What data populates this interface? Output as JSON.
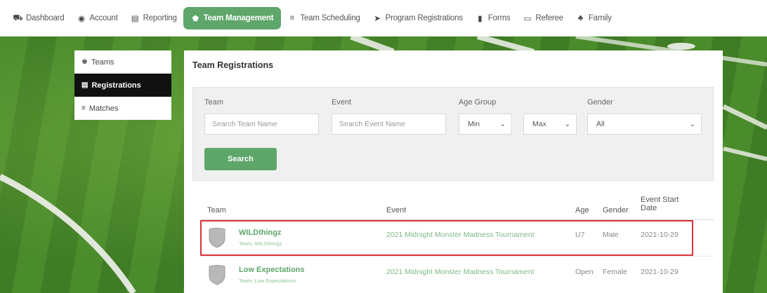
{
  "nav": {
    "items": [
      {
        "label": "Dashboard",
        "icon": "dashboard-icon",
        "glyph": "⛟"
      },
      {
        "label": "Account",
        "icon": "account-icon",
        "glyph": "◉"
      },
      {
        "label": "Reporting",
        "icon": "reporting-icon",
        "glyph": "▤"
      },
      {
        "label": "Team Management",
        "icon": "team-management-icon",
        "glyph": "♚",
        "active": true
      },
      {
        "label": "Team Scheduling",
        "icon": "team-scheduling-icon",
        "glyph": "≡"
      },
      {
        "label": "Program Registrations",
        "icon": "program-registrations-icon",
        "glyph": "➤"
      },
      {
        "label": "Forms",
        "icon": "forms-icon",
        "glyph": "▮"
      },
      {
        "label": "Referee",
        "icon": "referee-icon",
        "glyph": "▭"
      },
      {
        "label": "Family",
        "icon": "family-icon",
        "glyph": "♣"
      }
    ],
    "accent": "#5ea66a"
  },
  "sidebar": {
    "items": [
      {
        "label": "Teams",
        "glyph": "♚"
      },
      {
        "label": "Registrations",
        "glyph": "▤",
        "active": true
      },
      {
        "label": "Matches",
        "glyph": "≡"
      }
    ]
  },
  "panel": {
    "title": "Team Registrations"
  },
  "filters": {
    "team_label": "Team",
    "team_placeholder": "Search Team Name",
    "event_label": "Event",
    "event_placeholder": "Search Event Name",
    "age_group_label": "Age Group",
    "age_min": "Min",
    "age_max": "Max",
    "gender_label": "Gender",
    "gender_value": "All",
    "search_label": "Search"
  },
  "table": {
    "headers": {
      "team": "Team",
      "event": "Event",
      "age": "Age",
      "gender": "Gender",
      "start_line1": "Event Start",
      "start_line2": "Date"
    },
    "rows": [
      {
        "team": "WILDthingz",
        "sub": "Team: WILDthingz",
        "event": "2021 Midnight Monster Madness Tournament",
        "age": "U7",
        "gender": "Male",
        "date": "2021-10-29",
        "highlighted": true
      },
      {
        "team": "Low Expectations",
        "sub": "Team: Low Expectations",
        "event": "2021 Midnight Monster Madness Tournament",
        "age": "Open",
        "gender": "Female",
        "date": "2021-10-29",
        "highlighted": false
      }
    ]
  },
  "colors": {
    "accent": "#5ea66a",
    "highlight_border": "#d9333a",
    "sidebar_active": "#111111"
  }
}
